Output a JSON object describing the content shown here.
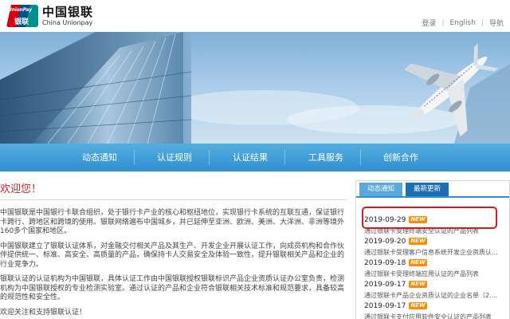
{
  "header": {
    "logo_badge_en": "UnionPay",
    "logo_badge_cn": "银联",
    "logo_cn": "中国银联",
    "logo_en": "China Unionpay",
    "links": [
      "登录",
      "English",
      "导航"
    ]
  },
  "nav": {
    "items": [
      "动态通知",
      "认证规则",
      "认证结果",
      "工具服务",
      "创新合作"
    ]
  },
  "main": {
    "welcome_title": "欢迎您！",
    "paragraphs": [
      "中国银联是中国银行卡联合组织，处于银行卡产业的核心和枢纽地位，实现银行卡系统的互联互通，保证银行卡跨行、跨地区和跨境的使用。银联网络遍布中国城乡，并已延伸至亚洲、欧洲、美洲、大洋洲、非洲等境外160多个国家和地区。",
      "中国银联建立了银联认证体系，对金融交付相关产品及其生产、开发企业开展认证工作，向成员机构和合作伙伴提供统一、标准、高安全、高质量的产品，确保持卡人交易安全及体验一致性，提升银联相关产品和企业的行业竞争力。",
      "银联认证的认证机构为中国银联，具体认证工作由中国银联授权银联标识产品企业资质认证办公室负责，检测机构为中国银联授权的专业检测实验室。通过认证的产品和企业符合银联相关技术标准和规范要求，具备较高的规范性和安全性。",
      "欢迎关注和支持银联认证！"
    ]
  },
  "panel": {
    "tabs": [
      "动态通知",
      "最新更新"
    ],
    "active_tab": "最新更新",
    "new_badge": "NEW",
    "news": [
      {
        "date": "2019-09-29",
        "title": "通过银联卡受理终端安全认证的产品列表"
      },
      {
        "date": "2019-09-20",
        "title": "通过银联卡受理客户信息系统开发企业资质认..."
      },
      {
        "date": "2019-09-18",
        "title": "通过银联卡受理终端应用认证的产品列表"
      },
      {
        "date": "2019-09-17",
        "title": "通过银联卡产品企业资质认证的企业名单（2...."
      },
      {
        "date": "2019-09-17",
        "title": "通过银联卡支付应用软件安全认证的产品列表"
      }
    ]
  },
  "colors": {
    "accent_red": "#c1272d",
    "nav_blue": "#2f8fcf",
    "highlight_red": "#e0161e",
    "new_badge": "#ff8a00"
  }
}
